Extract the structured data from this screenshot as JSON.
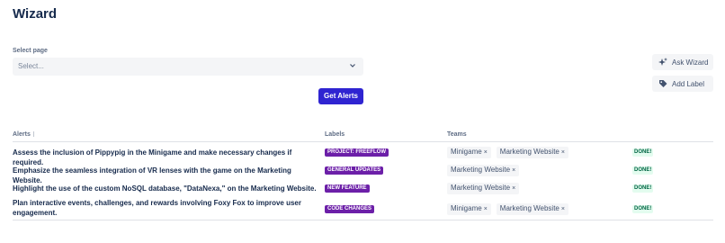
{
  "page_title": "Wizard",
  "select": {
    "label": "Select page",
    "placeholder": "Select..."
  },
  "actions": {
    "get_alerts": "Get Alerts",
    "ask_wizard": "Ask Wizard",
    "add_label": "Add Label"
  },
  "table": {
    "headers": {
      "alerts": "Alerts",
      "labels": "Labels",
      "teams": "Teams"
    },
    "rows": [
      {
        "alert": "Assess the inclusion of Pippypig in the Minigame and make necessary changes if required.",
        "label": "PROJECT: FREEFLOW",
        "teams": [
          "Minigame",
          "Marketing Website"
        ],
        "status": "DONE!"
      },
      {
        "alert": "Emphasize the seamless integration of VR lenses with the game on the Marketing Website.",
        "label": "GENERAL UPDATES",
        "teams": [
          "Marketing Website"
        ],
        "status": "DONE!"
      },
      {
        "alert": "Highlight the use of the custom NoSQL database, \"DataNexa,\" on the Marketing Website.",
        "label": "NEW FEATURE",
        "teams": [
          "Marketing Website"
        ],
        "status": "DONE!"
      },
      {
        "alert": "Plan interactive events, challenges, and rewards involving Foxy Fox to improve user engagement.",
        "label": "CODE CHANGES",
        "teams": [
          "Minigame",
          "Marketing Website"
        ],
        "status": "DONE!"
      }
    ]
  },
  "icons": {
    "ask_wizard": "sparkle-icon",
    "add_label": "tag-icon",
    "select": "chevron-down-icon",
    "chip_remove": "remove-icon"
  },
  "colors": {
    "primary": "#2f24d1",
    "label_bg": "#6c1fa8",
    "status_bg": "#e3fcef",
    "status_text": "#006644"
  }
}
